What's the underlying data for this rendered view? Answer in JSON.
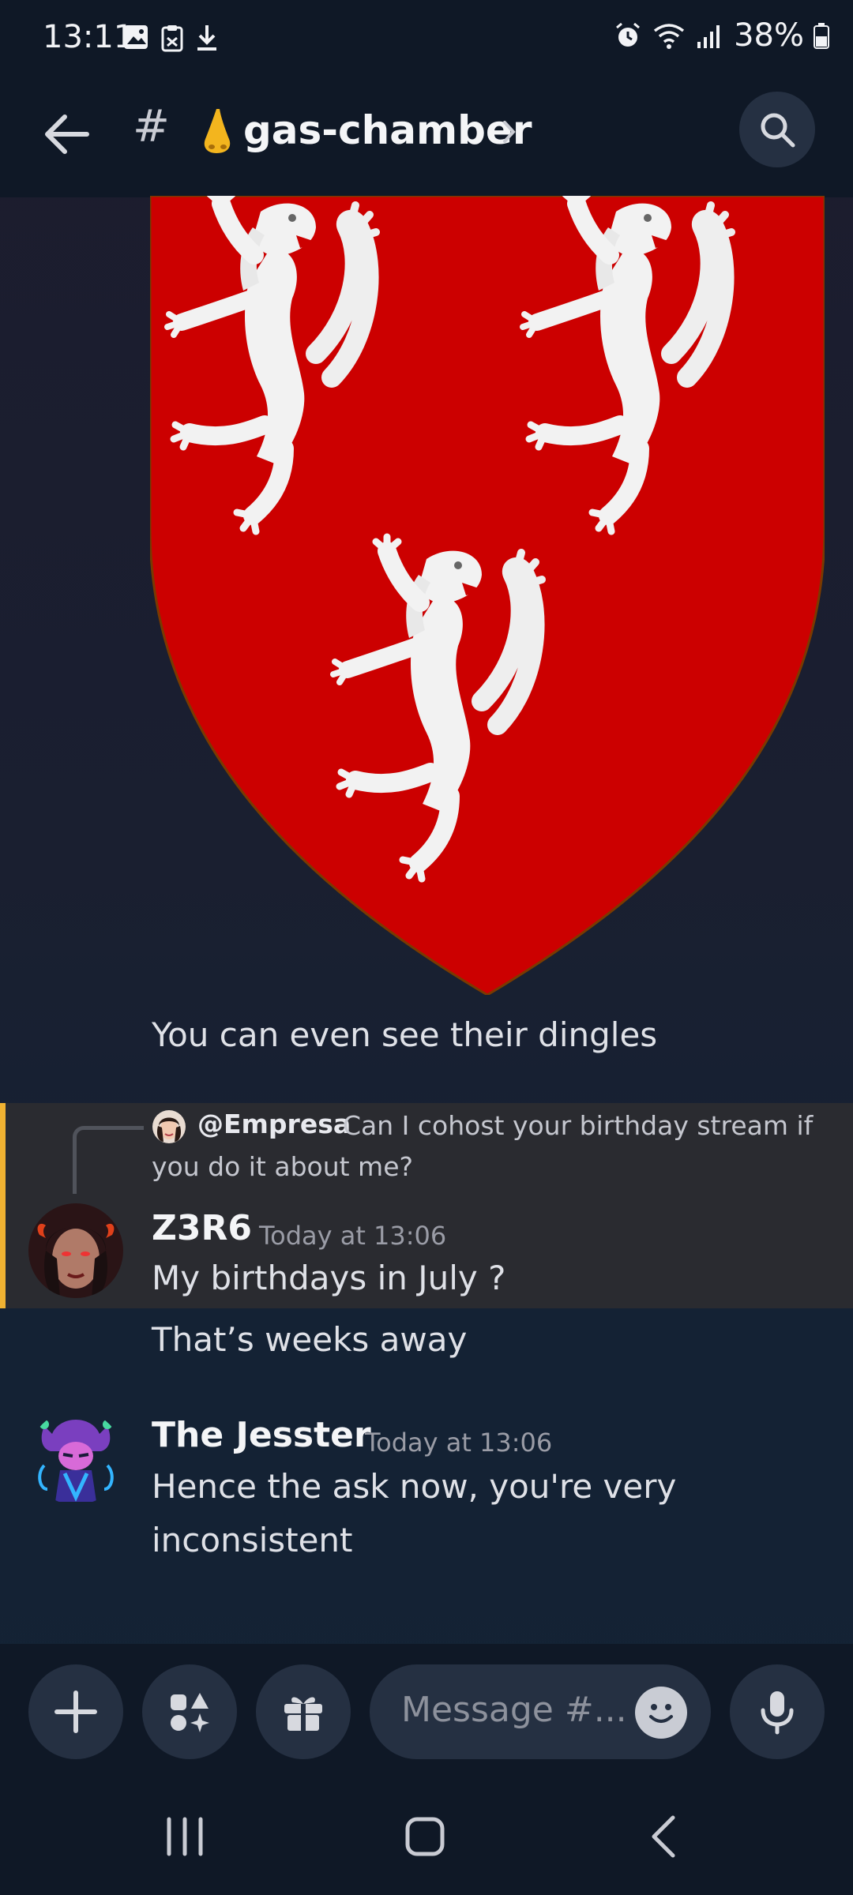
{
  "status_bar": {
    "time": "13:11",
    "battery": "38%"
  },
  "header": {
    "channel_prefix": "#",
    "channel_name": "gas-chamber"
  },
  "messages": [
    {
      "text": "You can even see their dingles"
    },
    {
      "reply": {
        "mention": "@Empresa",
        "text_line1": "Can I cohost your birthday stream if",
        "text_line2": "you do it about me?"
      },
      "author": "Z3R6",
      "timestamp": "Today at 13:06",
      "lines": [
        "My birthdays in July ?",
        "That’s weeks away"
      ]
    },
    {
      "author": "The Jesster",
      "timestamp": "Today at 13:06",
      "lines": [
        "Hence the ask now, you're very",
        "inconsistent"
      ]
    }
  ],
  "composer": {
    "placeholder": "Message #..."
  },
  "colors": {
    "highlight_bar": "#f0b232",
    "shield_red": "#cc0000"
  }
}
